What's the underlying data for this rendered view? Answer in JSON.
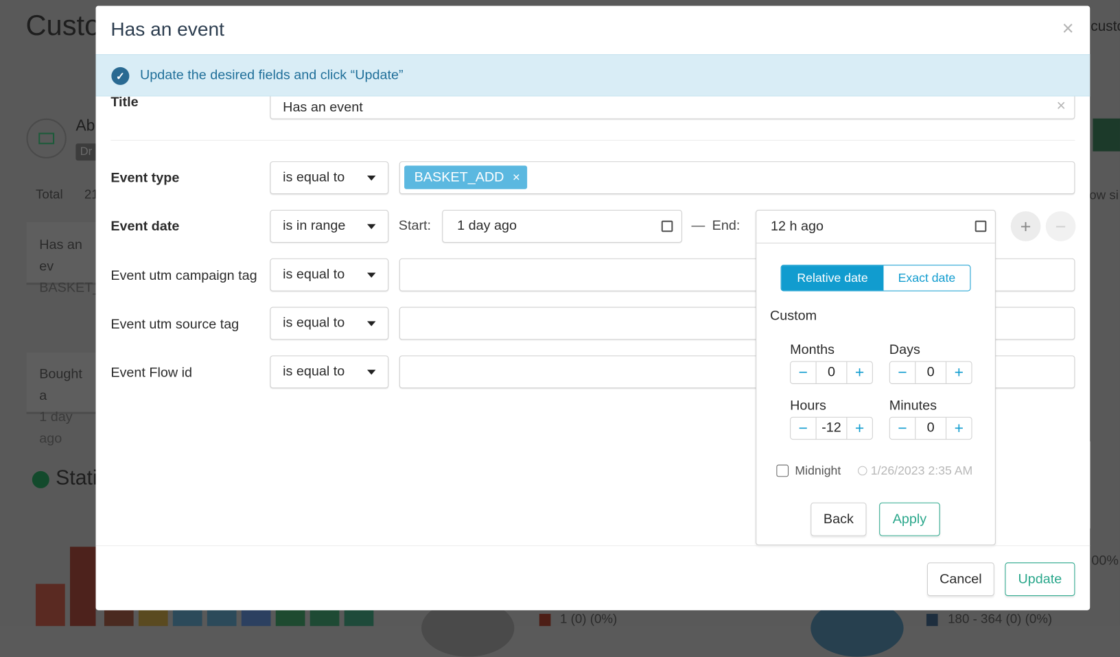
{
  "background": {
    "title": "Custo",
    "right_text": "custo",
    "card_initial": "Ab",
    "badge": "Dr",
    "total_label": "Total",
    "total_value": "21",
    "show_text": "ow si",
    "card1_line1": "Has an ev",
    "card1_line2": "BASKET_",
    "card2_line1": "Bought a",
    "card2_line2": "1 day ago",
    "stats_title": "Stati",
    "percent": "00%",
    "legend1": "1 (0) (0%)",
    "legend2": "180 - 364 (0) (0%)"
  },
  "modal": {
    "title": "Has an event",
    "info": "Update the desired fields and click “Update”",
    "fields": {
      "title_label": "Title",
      "title_value": "Has an event",
      "event_type_label": "Event type",
      "event_type_op": "is equal to",
      "event_type_tag": "BASKET_ADD",
      "event_date_label": "Event date",
      "event_date_op": "is in range",
      "start_label": "Start:",
      "start_value": "1 day ago",
      "dash": "—",
      "end_label": "End:",
      "end_value": "12 h ago",
      "utm_campaign_label": "Event utm campaign tag",
      "utm_campaign_op": "is equal to",
      "utm_source_label": "Event utm source tag",
      "utm_source_op": "is equal to",
      "flow_label": "Event Flow id",
      "flow_op": "is equal to"
    },
    "popover": {
      "tab_relative": "Relative date",
      "tab_exact": "Exact date",
      "active_tab": "Relative date",
      "custom": "Custom",
      "months_label": "Months",
      "months": "0",
      "days_label": "Days",
      "days": "0",
      "hours_label": "Hours",
      "hours": "-12",
      "minutes_label": "Minutes",
      "minutes": "0",
      "midnight": "Midnight",
      "midnight_checked": false,
      "resolved": "1/26/2023 2:35 AM",
      "back": "Back",
      "apply": "Apply"
    },
    "cancel": "Cancel",
    "update": "Update"
  },
  "colors": {
    "accent": "#119ccf",
    "teal": "#2aa78b",
    "tag": "#5bb8e0",
    "info_bg": "#d9edf6"
  }
}
